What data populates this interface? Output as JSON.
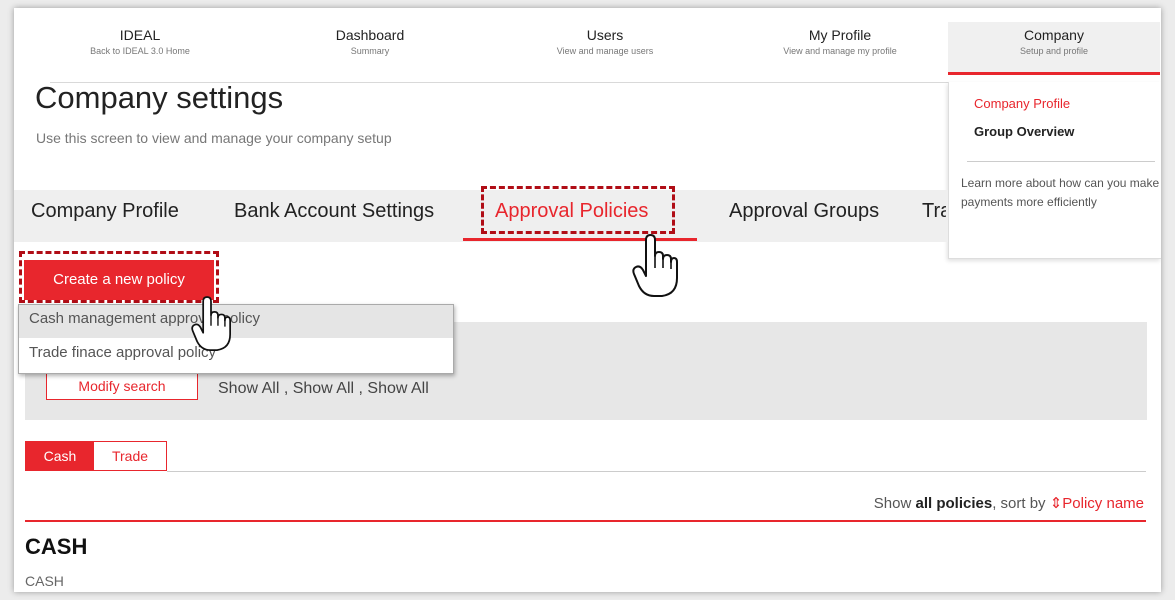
{
  "nav": [
    {
      "title": "IDEAL",
      "sub": "Back to IDEAL 3.0 Home"
    },
    {
      "title": "Dashboard",
      "sub": "Summary"
    },
    {
      "title": "Users",
      "sub": "View and manage users"
    },
    {
      "title": "My Profile",
      "sub": "View and manage my profile"
    },
    {
      "title": "Company",
      "sub": "Setup and profile"
    }
  ],
  "company_menu": {
    "items": [
      "Company Profile",
      "Group Overview"
    ],
    "learn": "Learn more about how can you make payments more efficiently"
  },
  "page": {
    "title": "Company settings",
    "subtitle": "Use this screen to view and manage your company setup"
  },
  "tabs": [
    "Company Profile",
    "Bank Account Settings",
    "Approval Policies",
    "Approval Groups",
    "Tra"
  ],
  "create_button": "Create a new policy",
  "dropdown_options": [
    "Cash management approval policy",
    "Trade finace approval policy"
  ],
  "filter": {
    "modify_button": "Modify search",
    "show_all": "Show All , Show All , Show All"
  },
  "toggle": {
    "cash": "Cash",
    "trade": "Trade"
  },
  "sort": {
    "show": "Show",
    "all_policies": "all policies",
    "sort_by": ", sort by",
    "arrow": "⇕",
    "field": "Policy name"
  },
  "section": {
    "heading": "CASH",
    "sub": "CASH"
  },
  "colors": {
    "accent": "#e8262d",
    "highlight": "#b00d16"
  }
}
